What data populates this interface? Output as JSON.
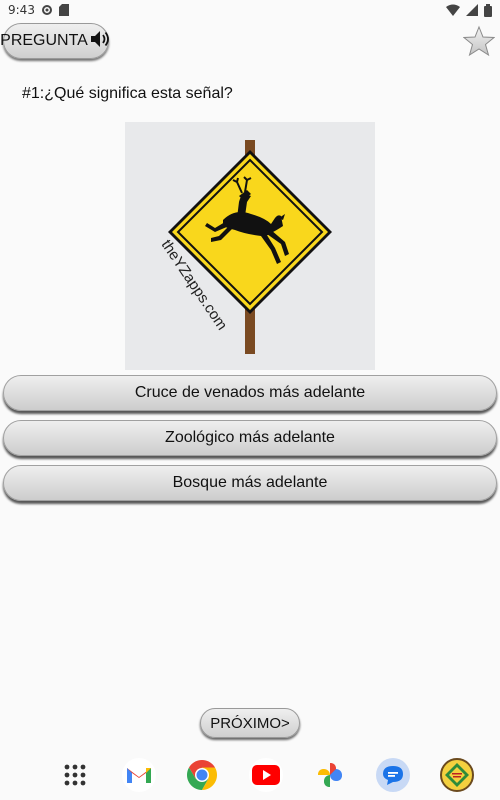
{
  "status_bar": {
    "time": "9:43",
    "icons": [
      "settings-icon",
      "sd-card-icon",
      "wifi-icon",
      "signal-icon",
      "battery-icon"
    ]
  },
  "toolbar": {
    "question_label": "PREGUNTA",
    "speaker_icon": "speaker-icon",
    "favorite_icon": "star-icon"
  },
  "question": {
    "text": "#1:¿Qué significa esta señal?",
    "sign_watermark": "theYZapps.com"
  },
  "answers": [
    {
      "label": "Cruce de venados más adelante"
    },
    {
      "label": "Zoológico más adelante"
    },
    {
      "label": "Bosque más adelante"
    }
  ],
  "navigation": {
    "next_label": "PRÓXIMO>"
  },
  "dock": {
    "apps": [
      "app-drawer-icon",
      "gmail-icon",
      "chrome-icon",
      "youtube-icon",
      "photos-icon",
      "messages-icon",
      "traffic-signs-app-icon"
    ]
  },
  "colors": {
    "sign_yellow": "#f9d71c",
    "button_gradient_top": "#efefef",
    "button_gradient_bottom": "#cdcdcd",
    "background": "#fafafa"
  }
}
